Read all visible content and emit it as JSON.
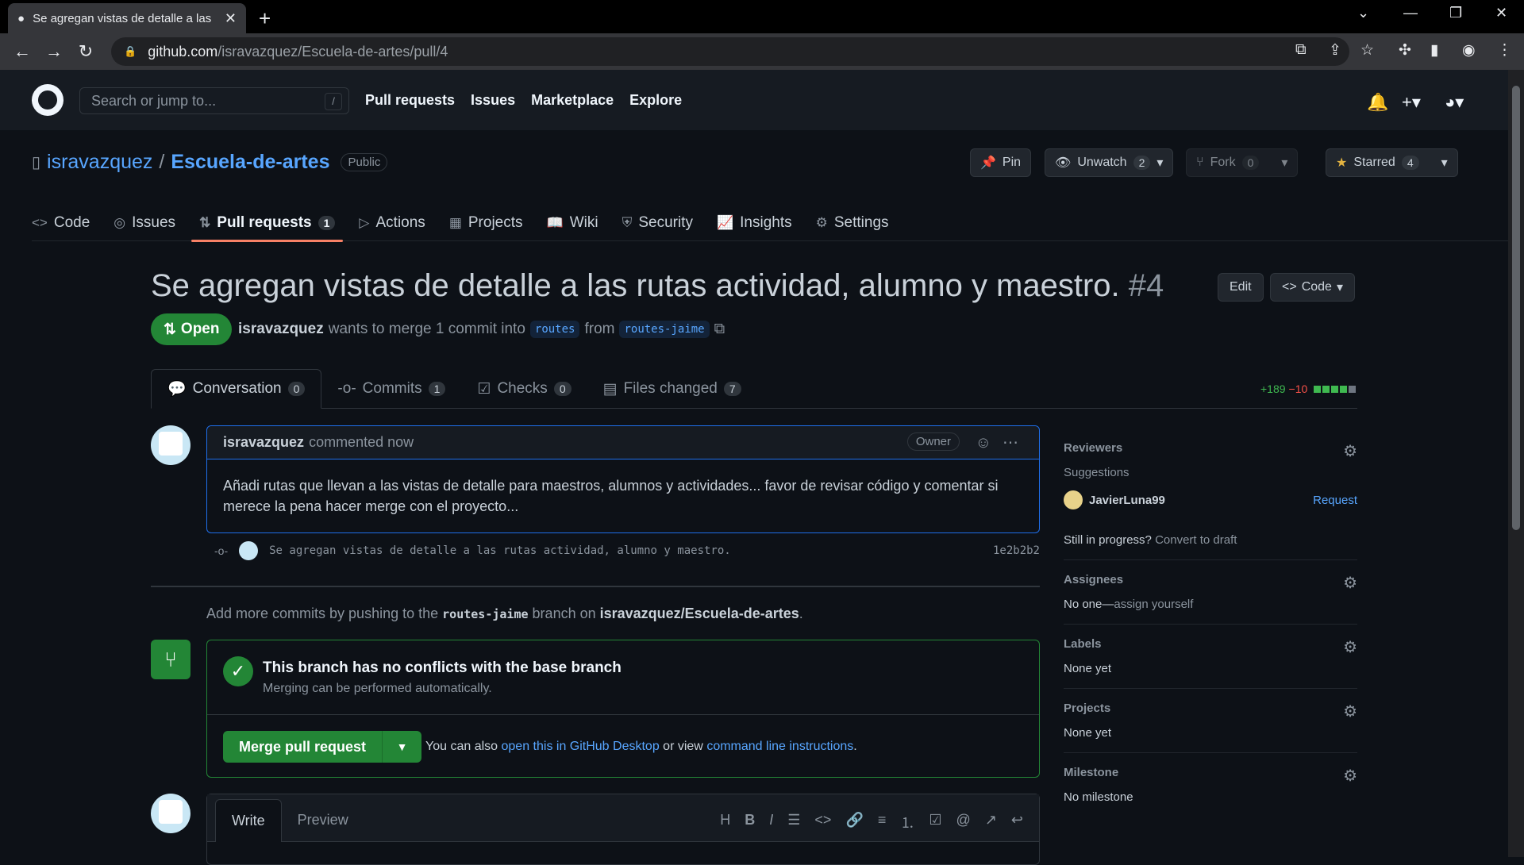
{
  "browser": {
    "tab_title": "Se agregan vistas de detalle a las",
    "url_host": "github.com",
    "url_path": "/isravazquez/Escuela-de-artes/pull/4"
  },
  "gh": {
    "search_placeholder": "Search or jump to...",
    "search_key": "/",
    "nav": [
      "Pull requests",
      "Issues",
      "Marketplace",
      "Explore"
    ]
  },
  "repo": {
    "owner": "isravazquez",
    "name": "Escuela-de-artes",
    "visibility": "Public",
    "pin_label": "Pin",
    "unwatch_label": "Unwatch",
    "unwatch_count": "2",
    "fork_label": "Fork",
    "fork_count": "0",
    "star_label": "Starred",
    "star_count": "4",
    "tabs": [
      {
        "label": "Code",
        "icon": "<>"
      },
      {
        "label": "Issues",
        "icon": "◎"
      },
      {
        "label": "Pull requests",
        "icon": "⇅",
        "count": "1"
      },
      {
        "label": "Actions",
        "icon": "▷"
      },
      {
        "label": "Projects",
        "icon": "▦"
      },
      {
        "label": "Wiki",
        "icon": "📖"
      },
      {
        "label": "Security",
        "icon": "⛨"
      },
      {
        "label": "Insights",
        "icon": "📈"
      },
      {
        "label": "Settings",
        "icon": "⚙"
      }
    ]
  },
  "pr": {
    "title": "Se agregan vistas de detalle a las rutas actividad, alumno y maestro.",
    "number": "#4",
    "edit_label": "Edit",
    "code_label": "Code",
    "state": "Open",
    "author": "isravazquez",
    "meta_text": "wants to merge 1 commit into",
    "base_branch": "routes",
    "from_text": "from",
    "head_branch": "routes-jaime",
    "tabs": [
      {
        "label": "Conversation",
        "count": "0"
      },
      {
        "label": "Commits",
        "count": "1"
      },
      {
        "label": "Checks",
        "count": "0"
      },
      {
        "label": "Files changed",
        "count": "7"
      }
    ],
    "additions": "+189",
    "deletions": "−10"
  },
  "comment": {
    "author": "isravazquez",
    "when": "commented now",
    "role": "Owner",
    "body": "Añadi rutas que llevan a las vistas de detalle para maestros, alumnos y actividades... favor de revisar código y comentar si merece la pena hacer merge con el proyecto..."
  },
  "commit": {
    "message": "Se agregan vistas de detalle a las rutas actividad, alumno y maestro.",
    "sha": "1e2b2b2"
  },
  "hint": {
    "prefix": "Add more commits by pushing to the",
    "branch": "routes-jaime",
    "middle": "branch on",
    "repo": "isravazquez/Escuela-de-artes",
    "suffix": "."
  },
  "merge": {
    "title": "This branch has no conflicts with the base branch",
    "subtitle": "Merging can be performed automatically.",
    "button": "Merge pull request",
    "alt_prefix": "You can also",
    "alt_link1": "open this in GitHub Desktop",
    "alt_mid": "or view",
    "alt_link2": "command line instructions",
    "alt_suffix": "."
  },
  "editor": {
    "write": "Write",
    "preview": "Preview"
  },
  "sidebar": {
    "reviewers_title": "Reviewers",
    "suggestions": "Suggestions",
    "suggested_user": "JavierLuna99",
    "request": "Request",
    "progress_text": "Still in progress?",
    "draft_link": "Convert to draft",
    "assignees_title": "Assignees",
    "assignees_none": "No one—",
    "assign_self": "assign yourself",
    "labels_title": "Labels",
    "labels_none": "None yet",
    "projects_title": "Projects",
    "projects_none": "None yet",
    "milestone_title": "Milestone",
    "milestone_none": "No milestone"
  }
}
